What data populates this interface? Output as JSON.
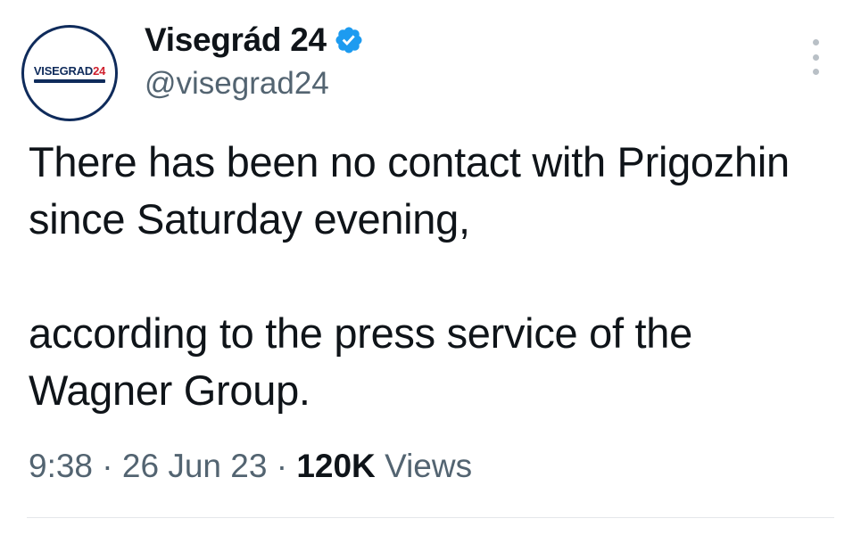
{
  "author": {
    "display_name": "Visegrád 24",
    "handle": "@visegrad24",
    "avatar": {
      "logo_text_main": "VISEGRAD",
      "logo_text_accent": "24",
      "colors": {
        "navy": "#0f2b5b",
        "red": "#d0202e"
      }
    },
    "verified_icon": "verified-badge-icon",
    "verified_color": "#1d9bf0"
  },
  "tweet": {
    "paragraphs": [
      "There has been no contact with Prigozhin since Saturday evening,",
      "according to the press service of the Wagner Group."
    ]
  },
  "meta": {
    "time": "9:38",
    "separator": "·",
    "date": "26 Jun 23",
    "views_count": "120K",
    "views_label": "Views"
  },
  "more_menu_icon": "more-vertical-icon"
}
